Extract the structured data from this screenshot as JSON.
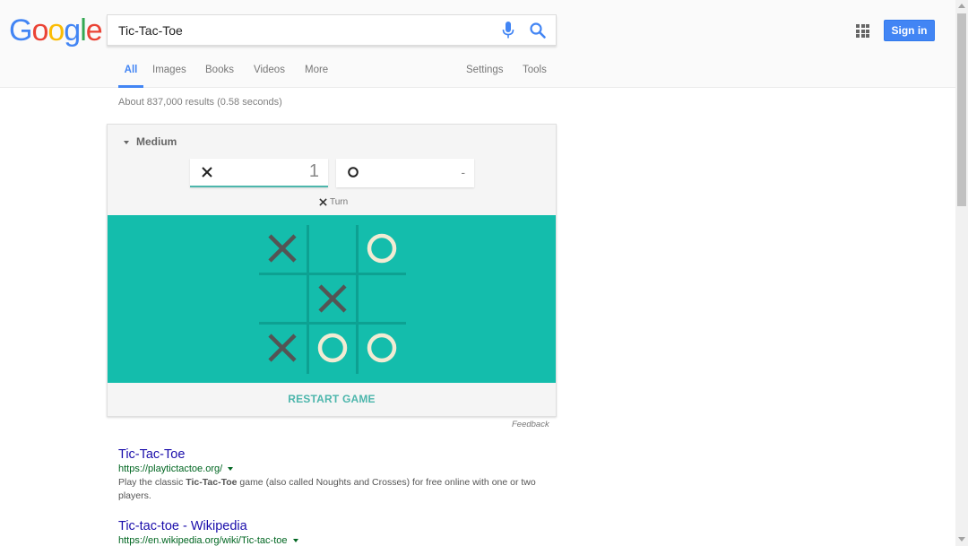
{
  "logo": {
    "text": "Google",
    "letters": [
      "G",
      "o",
      "o",
      "g",
      "l",
      "e"
    ],
    "colors": [
      "#4285f4",
      "#ea4335",
      "#fbbc05",
      "#4285f4",
      "#34a853",
      "#ea4335"
    ]
  },
  "search": {
    "query": "Tic-Tac-Toe",
    "mic_icon": "mic-icon",
    "search_icon": "search-icon"
  },
  "header": {
    "apps_icon": "apps-grid-icon",
    "signin_label": "Sign in",
    "accent": "#4285f4"
  },
  "tabs": [
    {
      "label": "All",
      "active": true
    },
    {
      "label": "Images",
      "active": false
    },
    {
      "label": "Books",
      "active": false
    },
    {
      "label": "Videos",
      "active": false
    },
    {
      "label": "More",
      "active": false
    },
    {
      "label": "Settings",
      "active": false
    },
    {
      "label": "Tools",
      "active": false
    }
  ],
  "stats": "About 837,000 results (0.58 seconds)",
  "game": {
    "difficulty": "Medium",
    "score_x": "1",
    "score_o": "-",
    "turn_label": "Turn",
    "turn_player": "X",
    "board": [
      [
        "X",
        "",
        "O"
      ],
      [
        "",
        "X",
        ""
      ],
      [
        "X",
        "O",
        "O"
      ]
    ],
    "board_color": "#14bdac",
    "restart_label": "RESTART GAME",
    "feedback_label": "Feedback"
  },
  "results": [
    {
      "title": "Tic-Tac-Toe",
      "url": "https://playtictactoe.org/",
      "snippet_parts": [
        {
          "text": "Play the classic ",
          "bold": false
        },
        {
          "text": "Tic-Tac-Toe",
          "bold": true
        },
        {
          "text": " game (also called Noughts and Crosses) for free online with one or two players.",
          "bold": false
        }
      ]
    },
    {
      "title": "Tic-tac-toe - Wikipedia",
      "url": "https://en.wikipedia.org/wiki/Tic-tac-toe",
      "snippet_parts": []
    }
  ]
}
